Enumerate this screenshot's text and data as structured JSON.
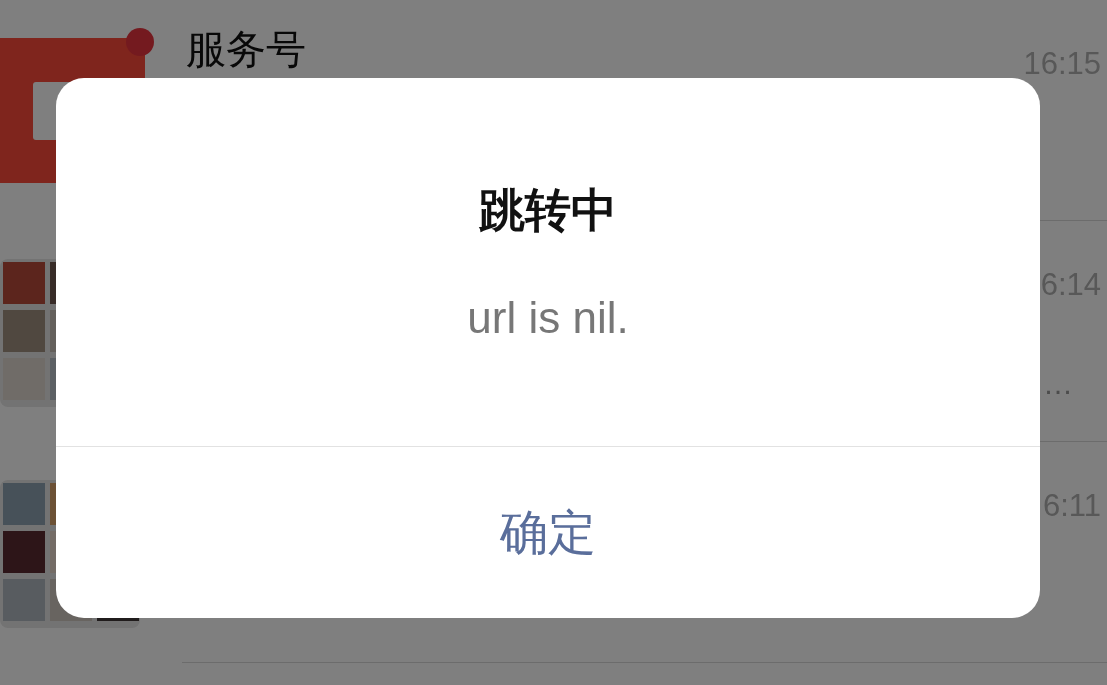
{
  "chat_list": [
    {
      "kind": "service",
      "name": "服务号",
      "time": "16:15",
      "unread": true
    },
    {
      "kind": "group",
      "time": "6:14",
      "preview": "…"
    },
    {
      "kind": "group",
      "time": "6:11"
    }
  ],
  "dialog": {
    "title": "跳转中",
    "message": "url is nil.",
    "buttons": [
      "确定"
    ]
  }
}
